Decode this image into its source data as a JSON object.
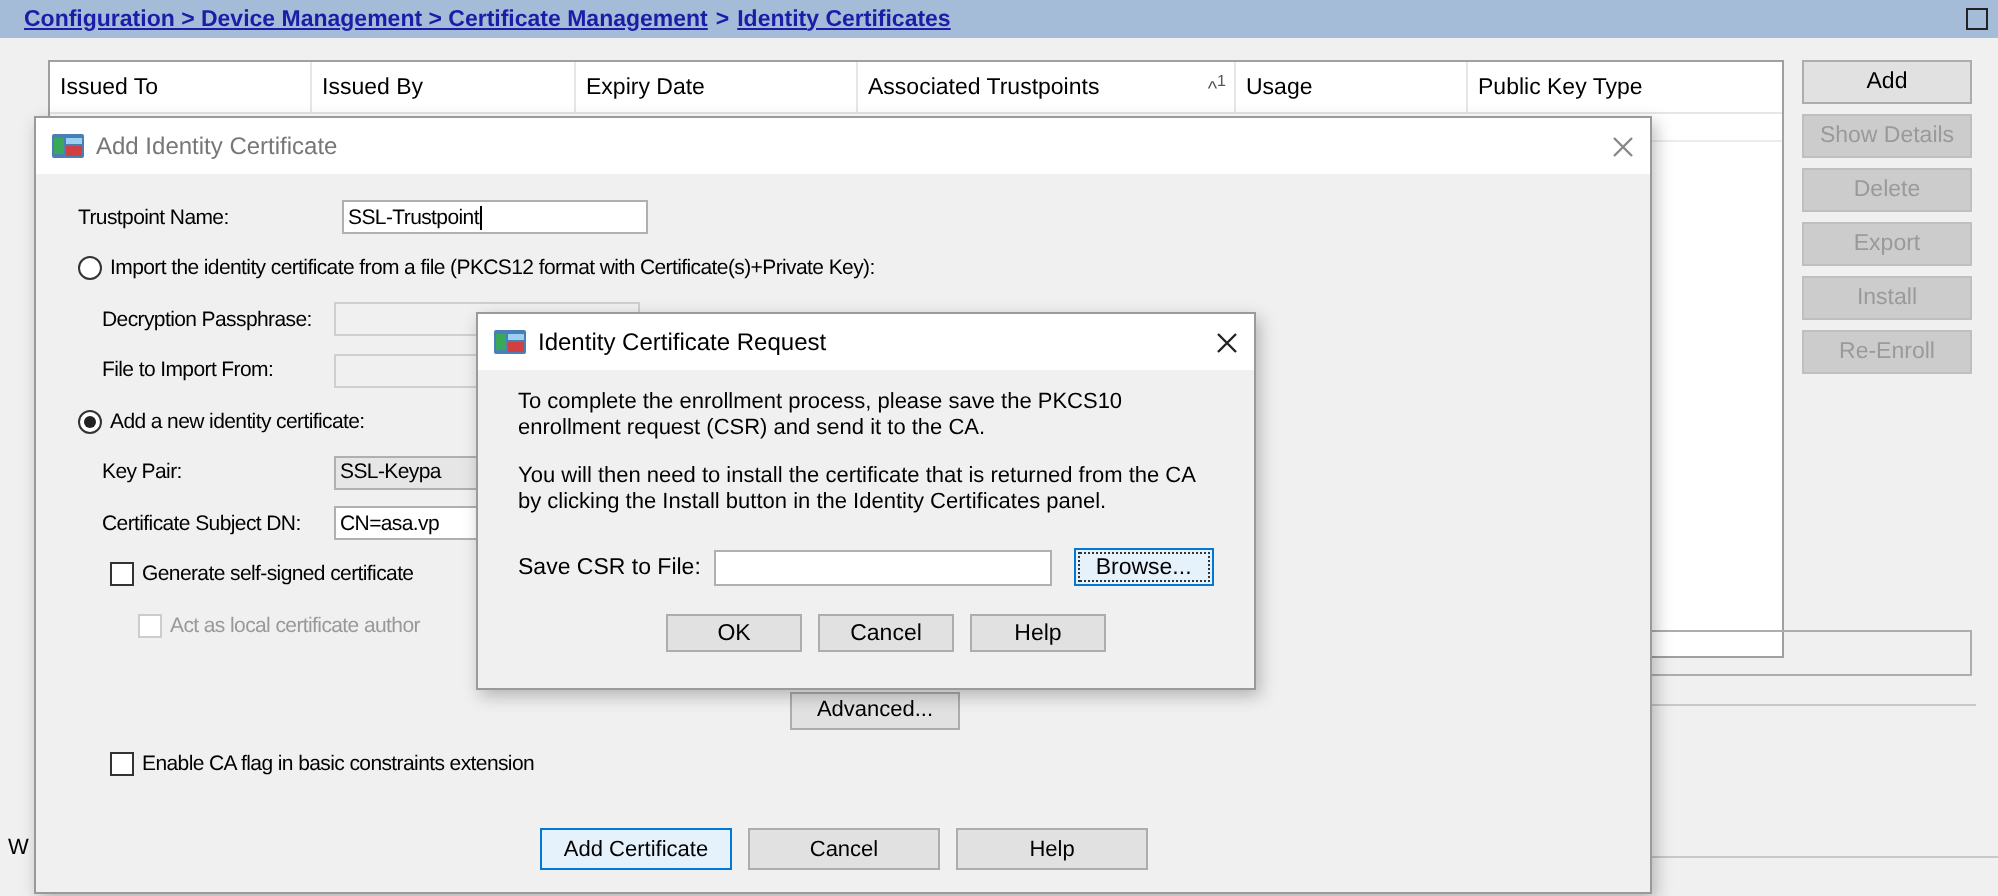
{
  "breadcrumb": [
    {
      "text": "Configuration > Device Management > Certificate Management",
      "kind": "link"
    },
    {
      "text": ">",
      "kind": "separator"
    },
    {
      "text": "Identity Certificates",
      "kind": "link"
    }
  ],
  "table": {
    "columns": [
      {
        "label": "Issued To"
      },
      {
        "label": "Issued By"
      },
      {
        "label": "Expiry Date"
      },
      {
        "label": "Associated Trustpoints",
        "sort_mark": "^",
        "sort_order": "1"
      },
      {
        "label": "Usage"
      },
      {
        "label": "Public Key Type"
      }
    ]
  },
  "side_buttons": [
    {
      "label": "Add",
      "disabled": false
    },
    {
      "label": "Show Details",
      "disabled": true
    },
    {
      "label": "Delete",
      "disabled": true
    },
    {
      "label": "Export",
      "disabled": true
    },
    {
      "label": "Install",
      "disabled": true
    },
    {
      "label": "Re-Enroll",
      "disabled": true
    }
  ],
  "footer_text": "W",
  "add_dialog": {
    "title": "Add Identity Certificate",
    "trustpoint": {
      "label": "Trustpoint Name:",
      "value": "SSL-Trustpoint"
    },
    "import_option": {
      "label": "Import the identity certificate from a file (PKCS12 format with Certificate(s)+Private Key):",
      "selected": false
    },
    "import_fields": [
      {
        "label": "Decryption Passphrase:"
      },
      {
        "label": "File to Import From:"
      }
    ],
    "new_option": {
      "label": "Add a new identity certificate:",
      "selected": true
    },
    "new_fields": [
      {
        "label": "Key Pair:",
        "value": "SSL-Keypa",
        "kind": "select"
      },
      {
        "label": "Certificate Subject DN:",
        "value": "CN=asa.vp",
        "kind": "text"
      }
    ],
    "self_signed": {
      "label": "Generate self-signed certificate",
      "checked": false,
      "disabled": false
    },
    "local_ca": {
      "label": "Act as local certificate author",
      "checked": false,
      "disabled": true
    },
    "advanced_button": "Advanced...",
    "ca_flag": {
      "label": "Enable CA flag in basic constraints extension",
      "checked": false,
      "disabled": false
    },
    "buttons": [
      {
        "label": "Add Certificate",
        "default": true
      },
      {
        "label": "Cancel",
        "default": false
      },
      {
        "label": "Help",
        "default": false
      }
    ]
  },
  "request_dialog": {
    "title": "Identity Certificate Request",
    "paragraphs": [
      "To complete the enrollment process, please save the PKCS10 enrollment request (CSR) and send it to the CA.",
      "You will then need to install the certificate that is returned from the CA by clicking the Install button in the Identity Certificates panel."
    ],
    "save_label": "Save CSR to File:",
    "browse_button": "Browse...",
    "buttons": [
      "OK",
      "Cancel",
      "Help"
    ]
  }
}
